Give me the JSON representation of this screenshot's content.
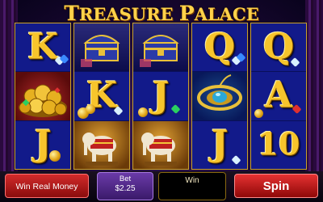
{
  "game": {
    "title_first_cap": "T",
    "title_rest_1": "REASURE ",
    "title_second_cap": "P",
    "title_rest_2": "ALACE"
  },
  "reels": [
    [
      "K",
      "treasure-gold",
      "J"
    ],
    [
      "treasure-chest",
      "K",
      "elephant"
    ],
    [
      "treasure-chest",
      "J",
      "elephant"
    ],
    [
      "Q",
      "amulet",
      "J"
    ],
    [
      "Q",
      "A",
      "10"
    ]
  ],
  "symbols": {
    "reel1_top": "K",
    "reel1_bottom": "J",
    "reel2_mid": "K",
    "reel3_mid": "J",
    "reel4_top": "Q",
    "reel4_bottom": "J",
    "reel5_top": "Q",
    "reel5_mid": "A",
    "reel5_bottom": "10"
  },
  "controls": {
    "win_real_money": "Win Real Money",
    "bet_label": "Bet",
    "bet_value": "$2.25",
    "win_label": "Win",
    "spin_label": "Spin"
  },
  "colors": {
    "reel_background": "#121a8a",
    "letter_gold": "#f7c52c",
    "spin_red": "#e63232",
    "bet_purple": "#6a3aa8"
  }
}
